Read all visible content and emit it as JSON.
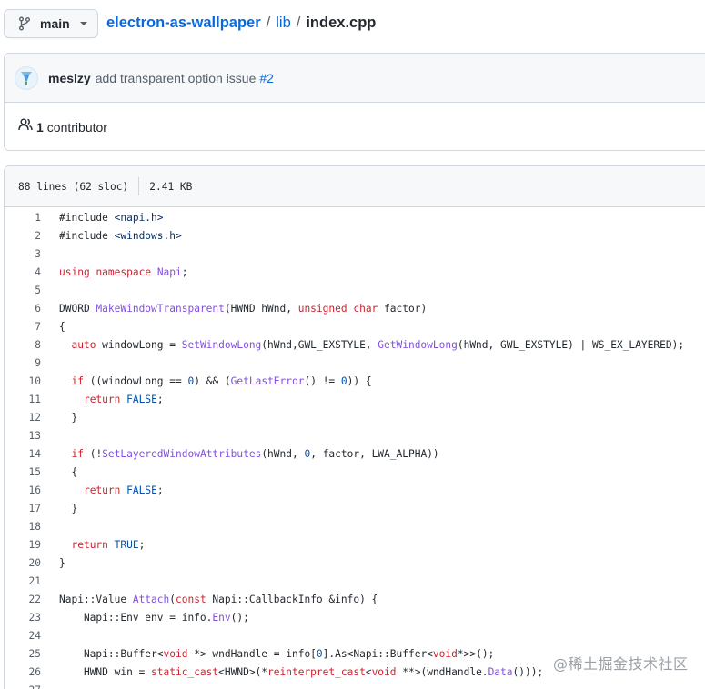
{
  "branch": {
    "name": "main"
  },
  "breadcrumb": {
    "repo": "electron-as-wallpaper",
    "sep1": "/",
    "folder": "lib",
    "sep2": "/",
    "file": "index.cpp"
  },
  "commit": {
    "author": "meslzy",
    "message": "add transparent option issue",
    "issue": "#2"
  },
  "contributors": {
    "count": "1",
    "label": "contributor"
  },
  "file_info": {
    "lines": "88 lines (62 sloc)",
    "size": "2.41 KB"
  },
  "code_lines": [
    {
      "n": "1",
      "t": [
        [
          "#include ",
          "p"
        ],
        [
          "<napi.h>",
          "s"
        ]
      ]
    },
    {
      "n": "2",
      "t": [
        [
          "#include ",
          "p"
        ],
        [
          "<windows.h>",
          "s"
        ]
      ]
    },
    {
      "n": "3",
      "t": []
    },
    {
      "n": "4",
      "t": [
        [
          "using",
          "k"
        ],
        [
          " ",
          "p"
        ],
        [
          "namespace",
          "k"
        ],
        [
          " ",
          "p"
        ],
        [
          "Napi",
          "f"
        ],
        [
          ";",
          "p"
        ]
      ]
    },
    {
      "n": "5",
      "t": []
    },
    {
      "n": "6",
      "t": [
        [
          "DWORD ",
          "p"
        ],
        [
          "MakeWindowTransparent",
          "f"
        ],
        [
          "(HWND hWnd, ",
          "p"
        ],
        [
          "unsigned",
          "k"
        ],
        [
          " ",
          "p"
        ],
        [
          "char",
          "k"
        ],
        [
          " factor)",
          "p"
        ]
      ]
    },
    {
      "n": "7",
      "t": [
        [
          "{",
          "p"
        ]
      ]
    },
    {
      "n": "8",
      "t": [
        [
          "  ",
          "p"
        ],
        [
          "auto",
          "k"
        ],
        [
          " windowLong = ",
          "p"
        ],
        [
          "SetWindowLong",
          "f"
        ],
        [
          "(hWnd,GWL_EXSTYLE, ",
          "p"
        ],
        [
          "GetWindowLong",
          "f"
        ],
        [
          "(hWnd, GWL_EXSTYLE) | WS_EX_LAYERED);",
          "p"
        ]
      ]
    },
    {
      "n": "9",
      "t": []
    },
    {
      "n": "10",
      "t": [
        [
          "  ",
          "p"
        ],
        [
          "if",
          "k"
        ],
        [
          " ((windowLong == ",
          "p"
        ],
        [
          "0",
          "n"
        ],
        [
          ") && (",
          "p"
        ],
        [
          "GetLastError",
          "f"
        ],
        [
          "() != ",
          "p"
        ],
        [
          "0",
          "n"
        ],
        [
          ")) {",
          "p"
        ]
      ]
    },
    {
      "n": "11",
      "t": [
        [
          "    ",
          "p"
        ],
        [
          "return",
          "k"
        ],
        [
          " ",
          "p"
        ],
        [
          "FALSE",
          "n"
        ],
        [
          ";",
          "p"
        ]
      ]
    },
    {
      "n": "12",
      "t": [
        [
          "  }",
          "p"
        ]
      ]
    },
    {
      "n": "13",
      "t": []
    },
    {
      "n": "14",
      "t": [
        [
          "  ",
          "p"
        ],
        [
          "if",
          "k"
        ],
        [
          " (!",
          "p"
        ],
        [
          "SetLayeredWindowAttributes",
          "f"
        ],
        [
          "(hWnd, ",
          "p"
        ],
        [
          "0",
          "n"
        ],
        [
          ", factor, LWA_ALPHA))",
          "p"
        ]
      ]
    },
    {
      "n": "15",
      "t": [
        [
          "  {",
          "p"
        ]
      ]
    },
    {
      "n": "16",
      "t": [
        [
          "    ",
          "p"
        ],
        [
          "return",
          "k"
        ],
        [
          " ",
          "p"
        ],
        [
          "FALSE",
          "n"
        ],
        [
          ";",
          "p"
        ]
      ]
    },
    {
      "n": "17",
      "t": [
        [
          "  }",
          "p"
        ]
      ]
    },
    {
      "n": "18",
      "t": []
    },
    {
      "n": "19",
      "t": [
        [
          "  ",
          "p"
        ],
        [
          "return",
          "k"
        ],
        [
          " ",
          "p"
        ],
        [
          "TRUE",
          "n"
        ],
        [
          ";",
          "p"
        ]
      ]
    },
    {
      "n": "20",
      "t": [
        [
          "}",
          "p"
        ]
      ]
    },
    {
      "n": "21",
      "t": []
    },
    {
      "n": "22",
      "t": [
        [
          "Napi::Value ",
          "p"
        ],
        [
          "Attach",
          "f"
        ],
        [
          "(",
          "p"
        ],
        [
          "const",
          "k"
        ],
        [
          " Napi::CallbackInfo &info) {",
          "p"
        ]
      ]
    },
    {
      "n": "23",
      "t": [
        [
          "    Napi::Env env = info.",
          "p"
        ],
        [
          "Env",
          "f"
        ],
        [
          "();",
          "p"
        ]
      ]
    },
    {
      "n": "24",
      "t": []
    },
    {
      "n": "25",
      "t": [
        [
          "    Napi::Buffer<",
          "p"
        ],
        [
          "void",
          "k"
        ],
        [
          " *> wndHandle = info[",
          "p"
        ],
        [
          "0",
          "n"
        ],
        [
          "].As<Napi::Buffer<",
          "p"
        ],
        [
          "void",
          "k"
        ],
        [
          "*>>();",
          "p"
        ]
      ]
    },
    {
      "n": "26",
      "t": [
        [
          "    HWND win = ",
          "p"
        ],
        [
          "static_cast",
          "k"
        ],
        [
          "<HWND>(*",
          "p"
        ],
        [
          "reinterpret_cast",
          "k"
        ],
        [
          "<",
          "p"
        ],
        [
          "void",
          "k"
        ],
        [
          " **>(wndHandle.",
          "p"
        ],
        [
          "Data",
          "f"
        ],
        [
          "()));",
          "p"
        ]
      ]
    },
    {
      "n": "27",
      "t": []
    }
  ],
  "watermark": "@稀土掘金技术社区"
}
